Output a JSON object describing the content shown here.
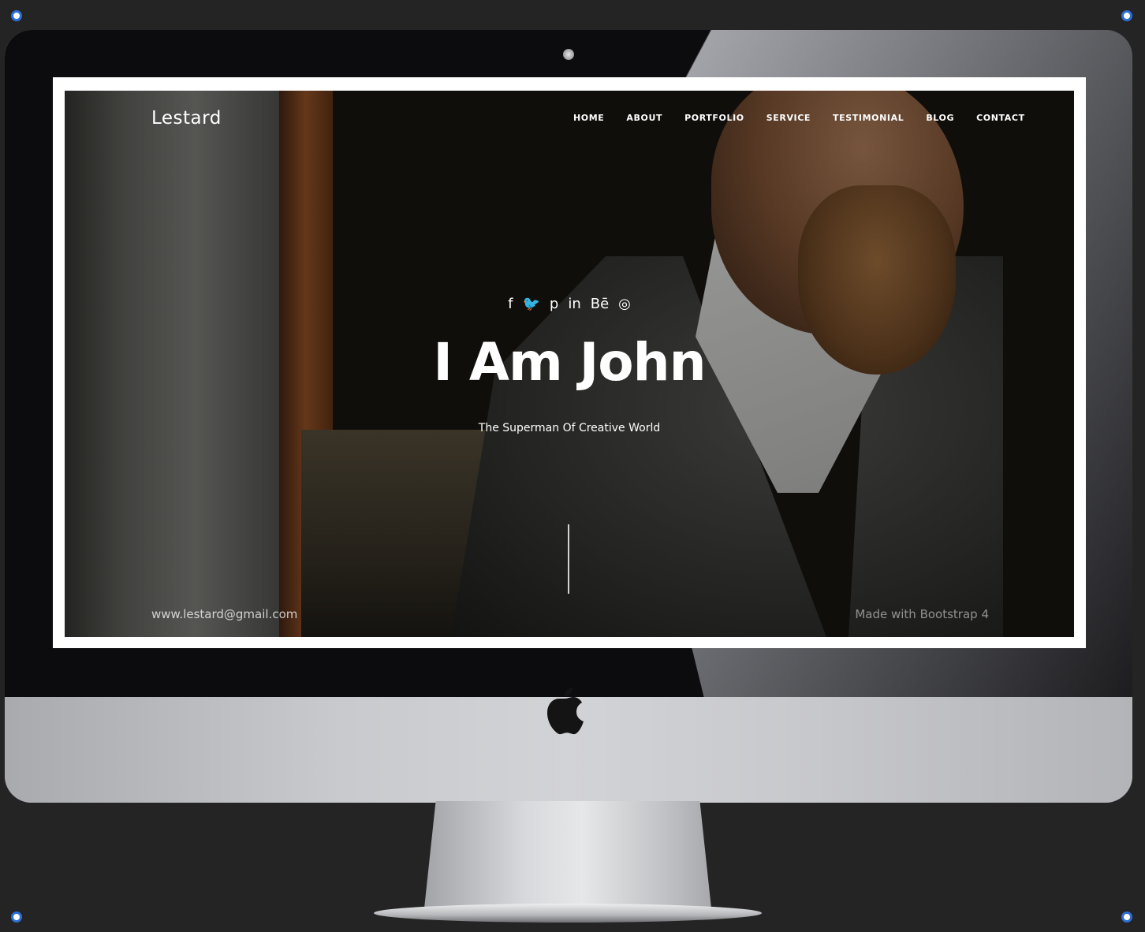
{
  "site": {
    "brand": "Lestard",
    "nav": [
      "HOME",
      "ABOUT",
      "PORTFOLIO",
      "SERVICE",
      "TESTIMONIAL",
      "BLOG",
      "CONTACT"
    ],
    "social_icons": [
      "facebook-icon",
      "twitter-icon",
      "pinterest-icon",
      "linkedin-icon",
      "behance-icon",
      "instagram-icon"
    ],
    "social_glyphs": [
      "f",
      "🐦",
      "p",
      "in",
      "Bē",
      "◎"
    ],
    "hero_title": "I Am John",
    "hero_subtitle": "The Superman Of Creative World",
    "email": "www.lestard@gmail.com",
    "credit": "Made with Bootstrap 4"
  },
  "colors": {
    "page_background": "#242424",
    "monitor_silver": "#c9cacd",
    "bezel": "#0c0c0e",
    "selection_handle": "#2d6fd6"
  }
}
